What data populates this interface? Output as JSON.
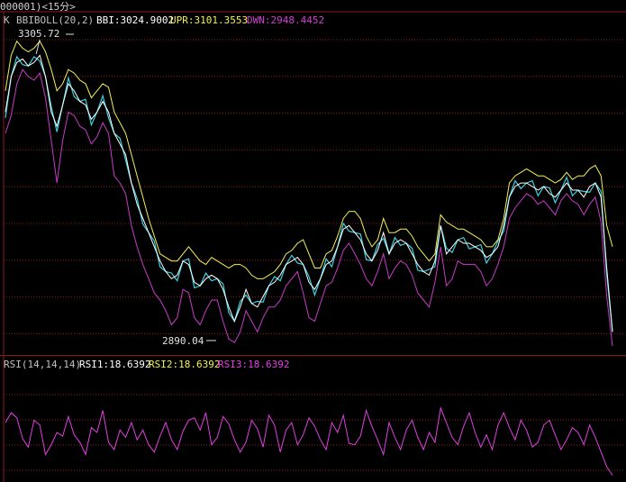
{
  "header": {
    "title": "000001)<15分>"
  },
  "main_panel": {
    "indicator": "K",
    "name": "BBIBOLL(20,2)",
    "bbi": "BBI:3024.9002",
    "upr": "UPR:3101.3553",
    "dwn": "DWN:2948.4452",
    "high_label": "3305.72",
    "low_label": "2890.04"
  },
  "rsi_panel": {
    "name": "RSI(14,14,14)",
    "rsi1": "RSI1:18.6392",
    "rsi2": "RSI2:18.6392",
    "rsi3": "RSI3:18.6392"
  },
  "colors": {
    "background": "#000000",
    "grid": "#8b1a1a",
    "upr": "#f2f254",
    "dwn": "#c83cc8",
    "bbi": "#ffffff",
    "price": "#3ad3e0",
    "rsi": "#e040e0",
    "label": "#e0e0e0"
  },
  "chart_data": [
    {
      "type": "line",
      "title": "",
      "ylim": [
        2860,
        3325
      ],
      "max_point": {
        "value": 3305.72,
        "index": 6
      },
      "min_point": {
        "value": 2890.04,
        "index": 40
      },
      "series": [
        {
          "name": "BBI",
          "values": [
            3200,
            3250,
            3270,
            3275,
            3265,
            3270,
            3280,
            3250,
            3200,
            3180,
            3210,
            3240,
            3230,
            3215,
            3210,
            3190,
            3200,
            3215,
            3200,
            3170,
            3155,
            3140,
            3100,
            3070,
            3050,
            3030,
            3010,
            2990,
            2975,
            2965,
            2970,
            2990,
            2985,
            2960,
            2955,
            2965,
            2970,
            2965,
            2950,
            2925,
            2905,
            2925,
            2950,
            2930,
            2925,
            2940,
            2955,
            2960,
            2970,
            2985,
            2990,
            2995,
            2985,
            2960,
            2950,
            2965,
            2985,
            2990,
            3010,
            3035,
            3040,
            3030,
            3020,
            3000,
            2990,
            3005,
            3030,
            3000,
            3015,
            3020,
            3015,
            3000,
            2985,
            2975,
            2970,
            2990,
            3040,
            3000,
            3010,
            3020,
            3015,
            3015,
            3010,
            3005,
            2995,
            3000,
            3010,
            3040,
            3080,
            3095,
            3100,
            3100,
            3095,
            3090,
            3095,
            3085,
            3080,
            3090,
            3100,
            3090,
            3090,
            3080,
            3095,
            3100,
            3080,
            2980,
            2890
          ]
        },
        {
          "name": "UPR",
          "values": [
            3230,
            3280,
            3300,
            3290,
            3285,
            3290,
            3300,
            3285,
            3260,
            3230,
            3240,
            3260,
            3255,
            3245,
            3240,
            3220,
            3230,
            3240,
            3235,
            3200,
            3185,
            3170,
            3140,
            3110,
            3080,
            3050,
            3025,
            3000,
            2995,
            2990,
            2990,
            3000,
            3010,
            3000,
            2990,
            2985,
            2995,
            2990,
            2985,
            2980,
            2985,
            2985,
            2980,
            2970,
            2965,
            2965,
            2970,
            2975,
            2985,
            3000,
            3005,
            3015,
            3020,
            3000,
            2980,
            2980,
            3000,
            3005,
            3025,
            3050,
            3060,
            3060,
            3050,
            3025,
            3010,
            3020,
            3050,
            3030,
            3030,
            3035,
            3035,
            3025,
            3010,
            3000,
            2990,
            3000,
            3055,
            3045,
            3040,
            3035,
            3035,
            3030,
            3025,
            3020,
            3010,
            3010,
            3020,
            3050,
            3100,
            3110,
            3115,
            3120,
            3115,
            3110,
            3110,
            3105,
            3100,
            3105,
            3115,
            3105,
            3110,
            3110,
            3120,
            3125,
            3110,
            3040,
            3010
          ]
        },
        {
          "name": "DWN",
          "values": [
            3170,
            3195,
            3240,
            3260,
            3250,
            3245,
            3255,
            3220,
            3160,
            3100,
            3160,
            3200,
            3195,
            3180,
            3175,
            3155,
            3165,
            3185,
            3170,
            3110,
            3100,
            3085,
            3040,
            3010,
            2985,
            2965,
            2945,
            2935,
            2920,
            2900,
            2910,
            2950,
            2945,
            2910,
            2900,
            2920,
            2935,
            2935,
            2905,
            2880,
            2875,
            2890,
            2920,
            2905,
            2890,
            2910,
            2925,
            2925,
            2935,
            2955,
            2965,
            2975,
            2945,
            2910,
            2905,
            2930,
            2955,
            2960,
            2980,
            3005,
            3015,
            3000,
            2985,
            2965,
            2955,
            2975,
            3000,
            2965,
            2980,
            2990,
            2985,
            2970,
            2945,
            2935,
            2925,
            2960,
            3010,
            2955,
            2965,
            2990,
            2985,
            2985,
            2985,
            2975,
            2955,
            2965,
            2985,
            3010,
            3050,
            3065,
            3075,
            3085,
            3080,
            3070,
            3075,
            3065,
            3055,
            3075,
            3085,
            3075,
            3070,
            3055,
            3070,
            3080,
            3045,
            2940,
            2870
          ]
        }
      ]
    },
    {
      "type": "line",
      "title": "",
      "ylim": [
        0,
        100
      ],
      "series": [
        {
          "name": "RSI1",
          "values": [
            58,
            66,
            62,
            45,
            38,
            60,
            56,
            32,
            40,
            50,
            47,
            63,
            48,
            42,
            32,
            54,
            50,
            68,
            42,
            36,
            52,
            46,
            58,
            44,
            52,
            40,
            34,
            47,
            58,
            44,
            36,
            51,
            60,
            62,
            52,
            66,
            40,
            46,
            63,
            57,
            44,
            34,
            42,
            60,
            53,
            38,
            64,
            56,
            34,
            52,
            58,
            40,
            48,
            62,
            55,
            44,
            36,
            58,
            50,
            64,
            41,
            40,
            47,
            68,
            55,
            44,
            32,
            58,
            46,
            36,
            52,
            60,
            46,
            36,
            50,
            42,
            70,
            58,
            46,
            40,
            55,
            66,
            50,
            38,
            48,
            36,
            56,
            66,
            54,
            44,
            60,
            52,
            38,
            42,
            56,
            60,
            48,
            36,
            44,
            54,
            50,
            40,
            56,
            46,
            34,
            22,
            15
          ]
        }
      ]
    }
  ]
}
